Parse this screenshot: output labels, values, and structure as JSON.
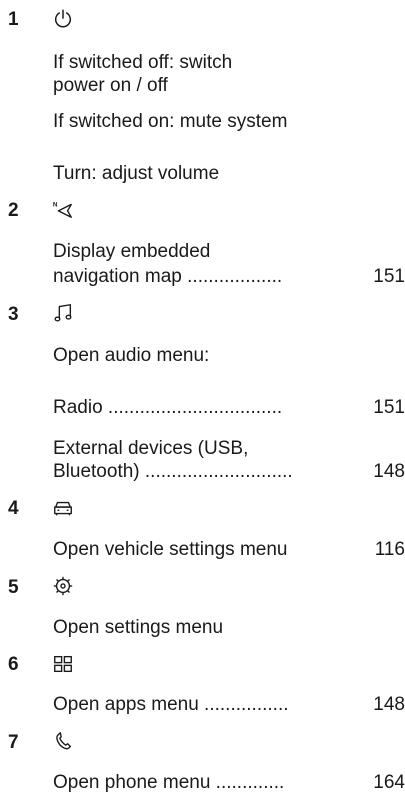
{
  "items": [
    {
      "number": "1",
      "icon": "power-icon",
      "lines": [
        "If switched off: switch",
        "power on / off",
        "If switched on: mute system",
        "Turn: adjust volume"
      ]
    },
    {
      "number": "2",
      "icon": "navigation-icon",
      "lines": [
        "Display embedded",
        "navigation map ..................",
        "151"
      ]
    },
    {
      "number": "3",
      "icon": "music-note-icon",
      "lines": [
        "Open audio menu:",
        "Radio .................................",
        "151",
        "External devices (USB,",
        "Bluetooth) ............................",
        "148"
      ]
    },
    {
      "number": "4",
      "icon": "car-icon",
      "lines": [
        "Open vehicle settings menu",
        "116"
      ]
    },
    {
      "number": "5",
      "icon": "gear-icon",
      "lines": [
        "Open settings menu"
      ]
    },
    {
      "number": "6",
      "icon": "apps-grid-icon",
      "lines": [
        "Open apps menu ................",
        "148"
      ]
    },
    {
      "number": "7",
      "icon": "phone-icon",
      "lines": [
        "Open phone menu .............",
        "164"
      ]
    }
  ]
}
